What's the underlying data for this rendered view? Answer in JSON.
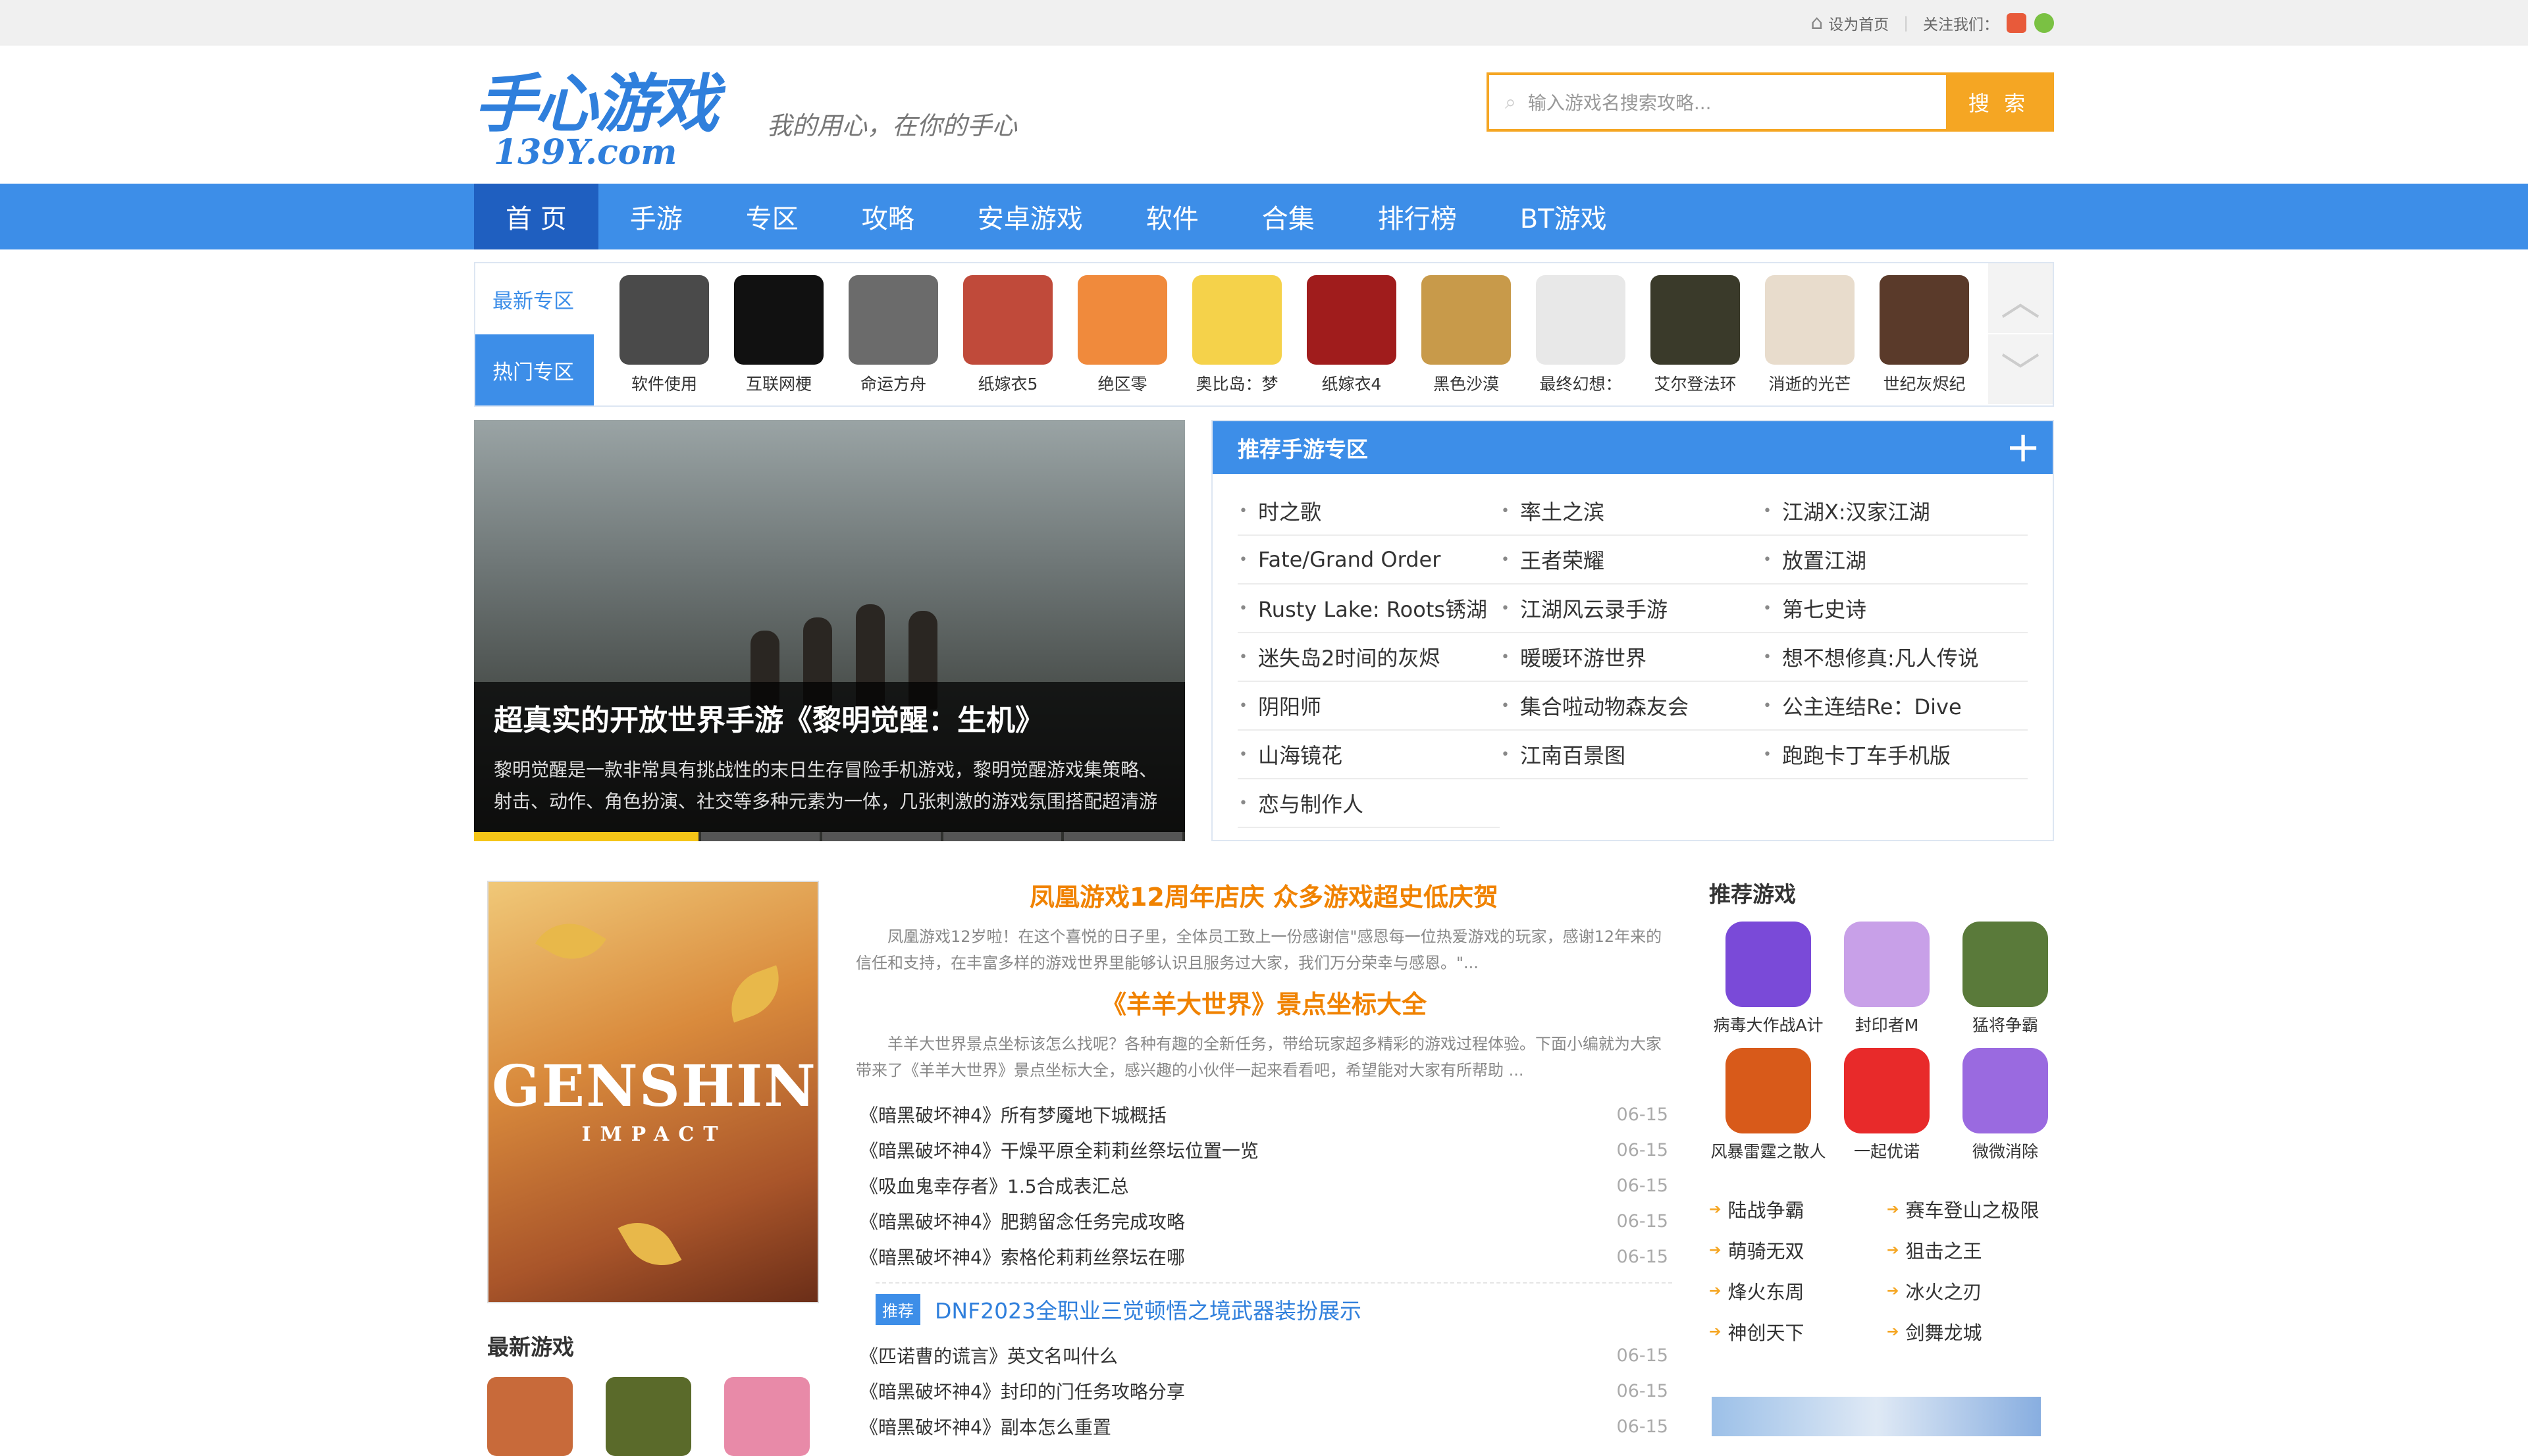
{
  "topbar": {
    "set_home": "设为首页",
    "follow": "关注我们："
  },
  "header": {
    "logo_text": "手心游戏",
    "logo_domain": "139Y.com",
    "slogan": "我的用心，在你的手心"
  },
  "search": {
    "placeholder": "输入游戏名搜索攻略...",
    "button": "搜 索"
  },
  "nav": {
    "items": [
      "首 页",
      "手游",
      "专区",
      "攻略",
      "安卓游戏",
      "软件",
      "合集",
      "排行榜",
      "BT游戏"
    ]
  },
  "zones": {
    "tabs": [
      "最新专区",
      "热门专区"
    ],
    "items": [
      {
        "name": "软件使用",
        "color": "#4a4a4a"
      },
      {
        "name": "互联网梗",
        "color": "#111111"
      },
      {
        "name": "命运方舟",
        "color": "#6b6b6b"
      },
      {
        "name": "纸嫁衣5",
        "color": "#c04a3a"
      },
      {
        "name": "绝区零",
        "color": "#f08a3c"
      },
      {
        "name": "奥比岛：梦",
        "color": "#f5d24a"
      },
      {
        "name": "纸嫁衣4",
        "color": "#a01c1c"
      },
      {
        "name": "黑色沙漠",
        "color": "#c89a4a"
      },
      {
        "name": "最终幻想：",
        "color": "#e8e8e8"
      },
      {
        "name": "艾尔登法环",
        "color": "#3a3a2a"
      },
      {
        "name": "消逝的光芒",
        "color": "#e8dccc"
      },
      {
        "name": "世纪灰烬纪",
        "color": "#5a3a2a"
      }
    ]
  },
  "banner": {
    "title": "超真实的开放世界手游《黎明觉醒：生机》",
    "desc": "黎明觉醒是一款非常具有挑战性的末日生存冒险手机游戏，黎明觉醒游戏集策略、射击、动作、角色扮演、社交等多种元素为一体，几张刺激的游戏氛围搭配超清游"
  },
  "recommend": {
    "title": "推荐手游专区",
    "items": [
      "时之歌",
      "率土之滨",
      "江湖X:汉家江湖",
      "Fate/Grand Order",
      "王者荣耀",
      "放置江湖",
      "Rusty Lake: Roots锈湖",
      "江湖风云录手游",
      "第七史诗",
      "迷失岛2时间的灰烬",
      "暖暖环游世界",
      "想不想修真:凡人传说",
      "阴阳师",
      "集合啦动物森友会",
      "公主连结Re：Dive",
      "山海镜花",
      "江南百景图",
      "跑跑卡丁车手机版",
      "恋与制作人"
    ]
  },
  "feature": {
    "title_line1": "GENSHIN",
    "title_line2": "IMPACT"
  },
  "news": {
    "headline1": "凤凰游戏12周年店庆 众多游戏超史低庆贺",
    "summary1": "凤凰游戏12岁啦！在这个喜悦的日子里，全体员工致上一份感谢信\"感恩每一位热爱游戏的玩家，感谢12年来的信任和支持，在丰富多样的游戏世界里能够认识且服务过大家，我们万分荣幸与感恩。\"...",
    "headline2": "《羊羊大世界》景点坐标大全",
    "summary2": "羊羊大世界景点坐标该怎么找呢？各种有趣的全新任务，带给玩家超多精彩的游戏过程体验。下面小编就为大家带来了《羊羊大世界》景点坐标大全，感兴趣的小伙伴一起来看看吧，希望能对大家有所帮助 ...",
    "list1": [
      {
        "title": "《暗黑破坏神4》所有梦魇地下城概括",
        "date": "06-15"
      },
      {
        "title": "《暗黑破坏神4》干燥平原全莉莉丝祭坛位置一览",
        "date": "06-15"
      },
      {
        "title": "《吸血鬼幸存者》1.5合成表汇总",
        "date": "06-15"
      },
      {
        "title": "《暗黑破坏神4》肥鹅留念任务完成攻略",
        "date": "06-15"
      },
      {
        "title": "《暗黑破坏神4》索格伦莉莉丝祭坛在哪",
        "date": "06-15"
      }
    ],
    "pick_tag": "推荐",
    "pick_title": "DNF2023全职业三觉顿悟之境武器装扮展示",
    "list2": [
      {
        "title": "《匹诺曹的谎言》英文名叫什么",
        "date": "06-15"
      },
      {
        "title": "《暗黑破坏神4》封印的门任务攻略分享",
        "date": "06-15"
      },
      {
        "title": "《暗黑破坏神4》副本怎么重置",
        "date": "06-15"
      }
    ]
  },
  "latest": {
    "title": "最新游戏"
  },
  "side": {
    "title": "推荐游戏",
    "games": [
      {
        "name": "病毒大作战A计",
        "color": "#7a4ad8"
      },
      {
        "name": "封印者M",
        "color": "#c8a0e8"
      },
      {
        "name": "猛将争霸",
        "color": "#5a7a3a"
      },
      {
        "name": "风暴雷霆之散人",
        "color": "#d85a1a"
      },
      {
        "name": "一起优诺",
        "color": "#e82a2a"
      },
      {
        "name": "微微消除",
        "color": "#9a6ae0"
      }
    ],
    "list": [
      "陆战争霸",
      "赛车登山之极限",
      "萌骑无双",
      "狙击之王",
      "烽火东周",
      "冰火之刃",
      "神创天下",
      "剑舞龙城"
    ]
  }
}
